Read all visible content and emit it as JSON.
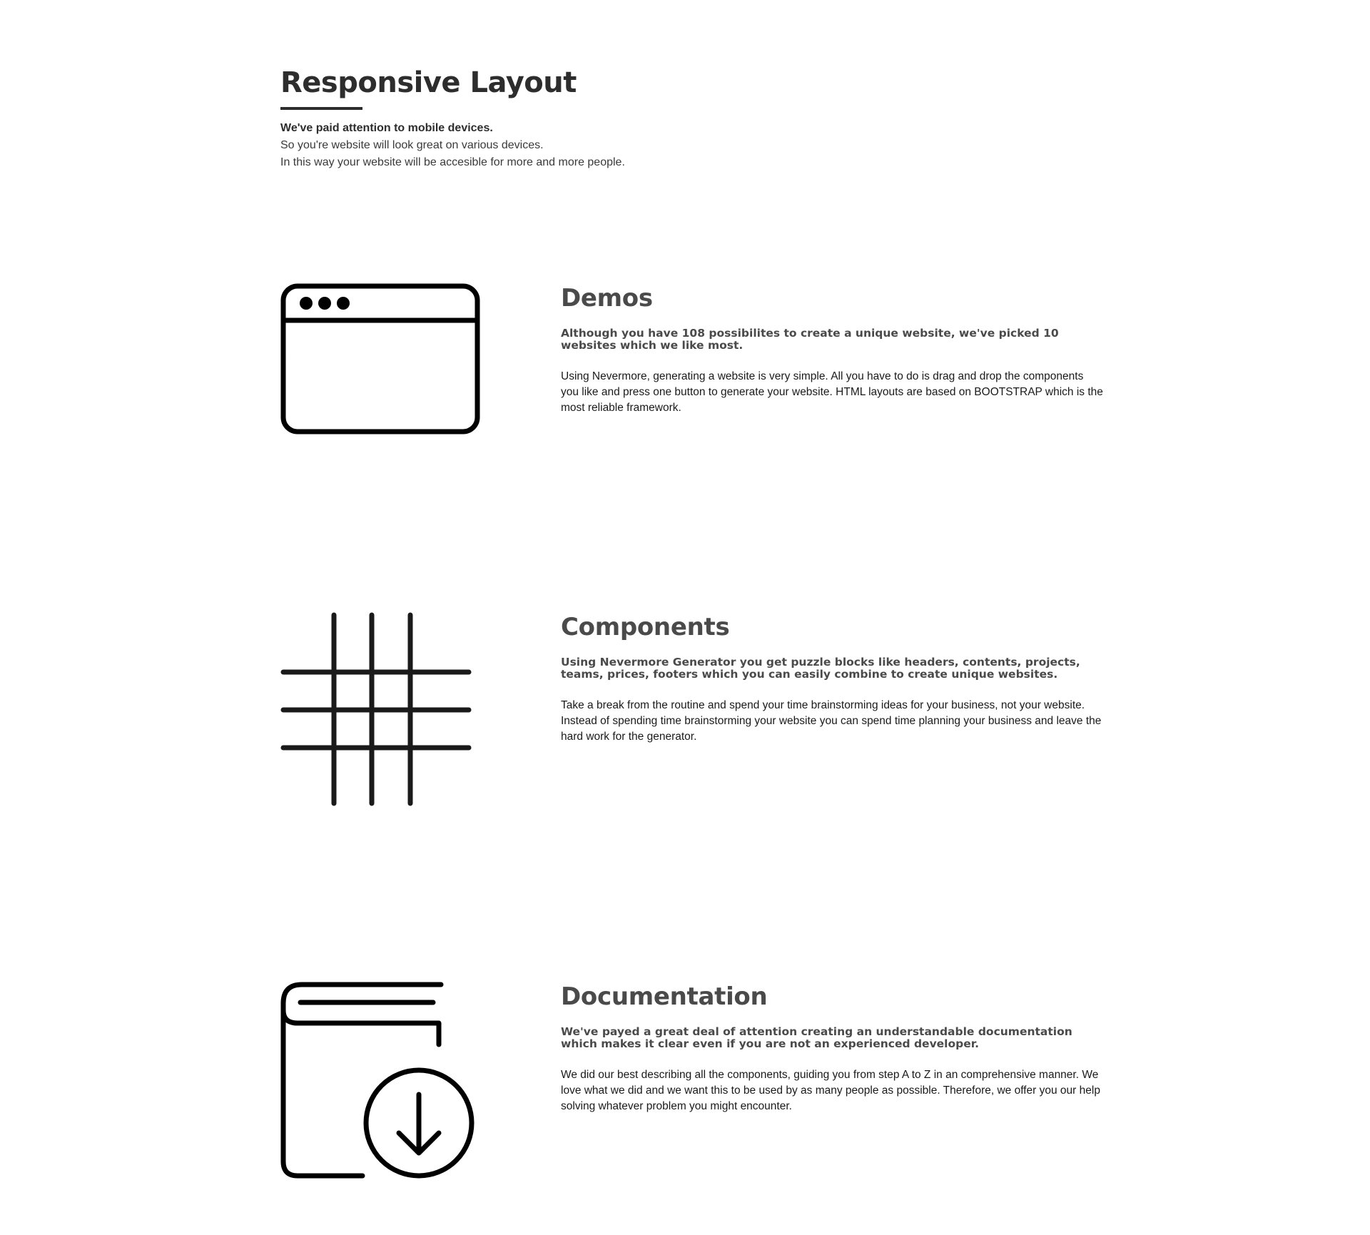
{
  "header": {
    "title": "Responsive Layout",
    "lead": "We've paid attention to mobile devices.",
    "lines": [
      "So you're website will look great on various devices.",
      "In this way your website will be accesible for more and more people."
    ]
  },
  "features": [
    {
      "icon": "browser-window-icon",
      "title": "Demos",
      "lead": "Although you have 108 possibilites to create a unique website, we've picked 10 websites which we like most.",
      "text": "Using Nevermore, generating a website is very simple. All you have to do is drag and drop the components you like and press one button to generate your website. HTML layouts are based on BOOTSTRAP which is the most reliable framework."
    },
    {
      "icon": "grid-icon",
      "title": "Components",
      "lead": "Using Nevermore Generator you get puzzle blocks like headers, contents, projects, teams, prices, footers which you can easily combine to create unique websites.",
      "text": "Take a break from the routine and spend your time brainstorming ideas for your business, not your website. Instead of spending time brainstorming your website you can spend time planning your business and leave the hard work for the generator."
    },
    {
      "icon": "book-download-icon",
      "title": "Documentation",
      "lead": "We've payed a great deal of attention creating an understandable documentation which makes it clear even if you are not an experienced developer.",
      "text": "We did our best describing all the components, guiding you from step A to Z in an comprehensive manner. We love what we did and we want this to be used by as many people as possible. Therefore, we offer you our help solving whatever problem you might encounter."
    }
  ]
}
